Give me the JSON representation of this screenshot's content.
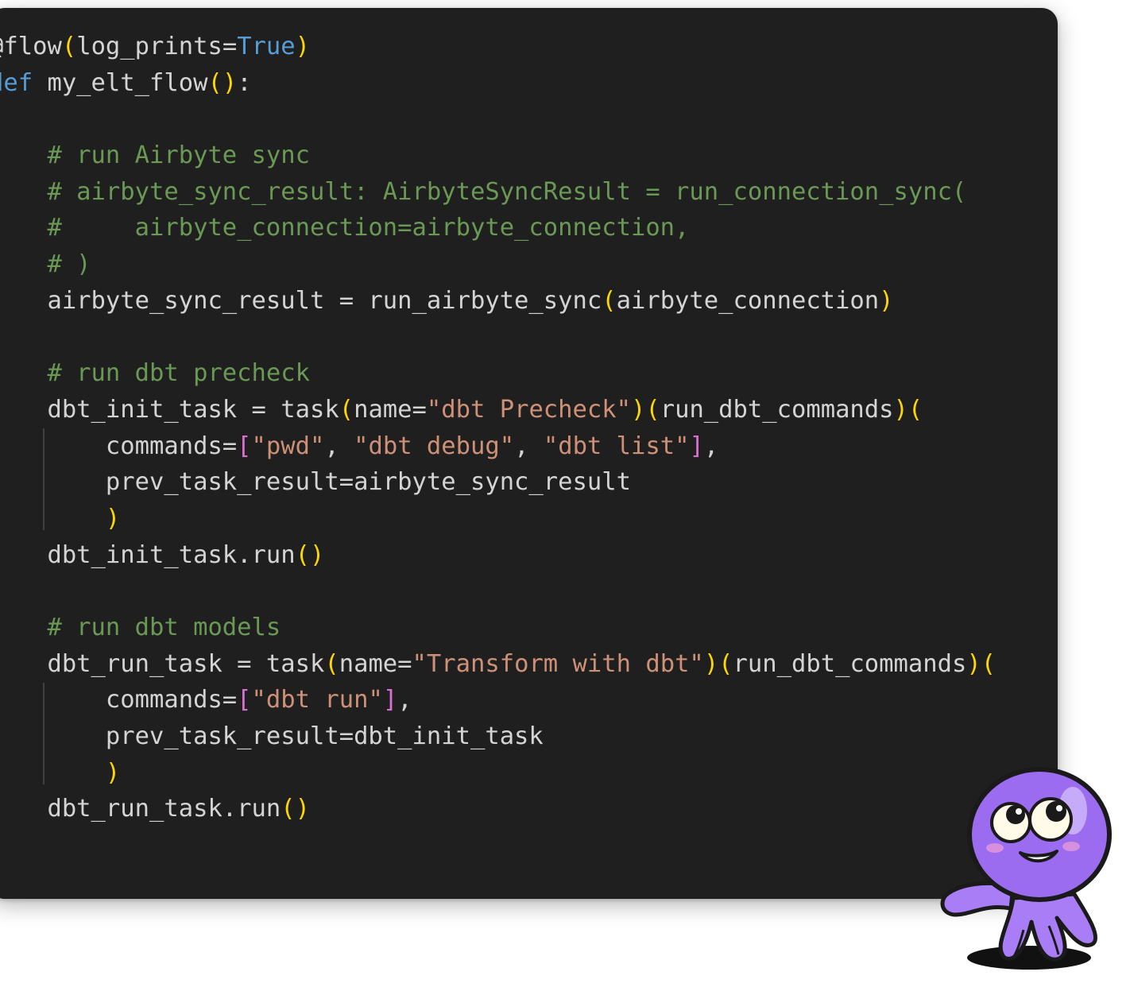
{
  "editor": {
    "theme_colors": {
      "background": "#1f1f1f",
      "text": "#d4d4d4",
      "keyword": "#569cd6",
      "comment": "#6a9955",
      "string": "#ce9178",
      "bracket": "#ffd700",
      "bracket_nested": "#da70d6"
    },
    "lines": [
      [
        {
          "t": "@flow",
          "c": "txt"
        },
        {
          "t": "(",
          "c": "br"
        },
        {
          "t": "log_prints=",
          "c": "txt"
        },
        {
          "t": "True",
          "c": "const"
        },
        {
          "t": ")",
          "c": "br"
        }
      ],
      [
        {
          "t": "def",
          "c": "kw"
        },
        {
          "t": " my_elt_flow",
          "c": "txt"
        },
        {
          "t": "()",
          "c": "br"
        },
        {
          "t": ":",
          "c": "txt"
        }
      ],
      [],
      [
        {
          "t": "    # run Airbyte sync",
          "c": "com"
        }
      ],
      [
        {
          "t": "    # airbyte_sync_result: AirbyteSyncResult = run_connection_sync(",
          "c": "com"
        }
      ],
      [
        {
          "t": "    #     airbyte_connection=airbyte_connection,",
          "c": "com"
        }
      ],
      [
        {
          "t": "    # )",
          "c": "com"
        }
      ],
      [
        {
          "t": "    airbyte_sync_result = run_airbyte_sync",
          "c": "txt"
        },
        {
          "t": "(",
          "c": "br"
        },
        {
          "t": "airbyte_connection",
          "c": "txt"
        },
        {
          "t": ")",
          "c": "br"
        }
      ],
      [],
      [
        {
          "t": "    # run dbt precheck",
          "c": "com"
        }
      ],
      [
        {
          "t": "    dbt_init_task = task",
          "c": "txt"
        },
        {
          "t": "(",
          "c": "br"
        },
        {
          "t": "name=",
          "c": "txt"
        },
        {
          "t": "\"dbt Precheck\"",
          "c": "str"
        },
        {
          "t": ")(",
          "c": "br"
        },
        {
          "t": "run_dbt_commands",
          "c": "txt"
        },
        {
          "t": ")(",
          "c": "br"
        }
      ],
      [
        {
          "t": "        commands=",
          "c": "txt"
        },
        {
          "t": "[",
          "c": "br2"
        },
        {
          "t": "\"pwd\"",
          "c": "str"
        },
        {
          "t": ", ",
          "c": "txt"
        },
        {
          "t": "\"dbt debug\"",
          "c": "str"
        },
        {
          "t": ", ",
          "c": "txt"
        },
        {
          "t": "\"dbt list\"",
          "c": "str"
        },
        {
          "t": "]",
          "c": "br2"
        },
        {
          "t": ",",
          "c": "txt"
        }
      ],
      [
        {
          "t": "        prev_task_result=airbyte_sync_result",
          "c": "txt"
        }
      ],
      [
        {
          "t": "        )",
          "c": "br"
        }
      ],
      [
        {
          "t": "    dbt_init_task.run",
          "c": "txt"
        },
        {
          "t": "()",
          "c": "br"
        }
      ],
      [],
      [
        {
          "t": "    # run dbt models",
          "c": "com"
        }
      ],
      [
        {
          "t": "    dbt_run_task = task",
          "c": "txt"
        },
        {
          "t": "(",
          "c": "br"
        },
        {
          "t": "name=",
          "c": "txt"
        },
        {
          "t": "\"Transform with dbt\"",
          "c": "str"
        },
        {
          "t": ")(",
          "c": "br"
        },
        {
          "t": "run_dbt_commands",
          "c": "txt"
        },
        {
          "t": ")(",
          "c": "br"
        }
      ],
      [
        {
          "t": "        commands=",
          "c": "txt"
        },
        {
          "t": "[",
          "c": "br2"
        },
        {
          "t": "\"dbt run\"",
          "c": "str"
        },
        {
          "t": "]",
          "c": "br2"
        },
        {
          "t": ",",
          "c": "txt"
        }
      ],
      [
        {
          "t": "        prev_task_result=dbt_init_task",
          "c": "txt"
        }
      ],
      [
        {
          "t": "        )",
          "c": "br"
        }
      ],
      [
        {
          "t": "    dbt_run_task.run",
          "c": "txt"
        },
        {
          "t": "()",
          "c": "br"
        }
      ]
    ]
  },
  "mascot": {
    "icon": "purple-octopus-mascot",
    "color": "#9b6cf0"
  }
}
